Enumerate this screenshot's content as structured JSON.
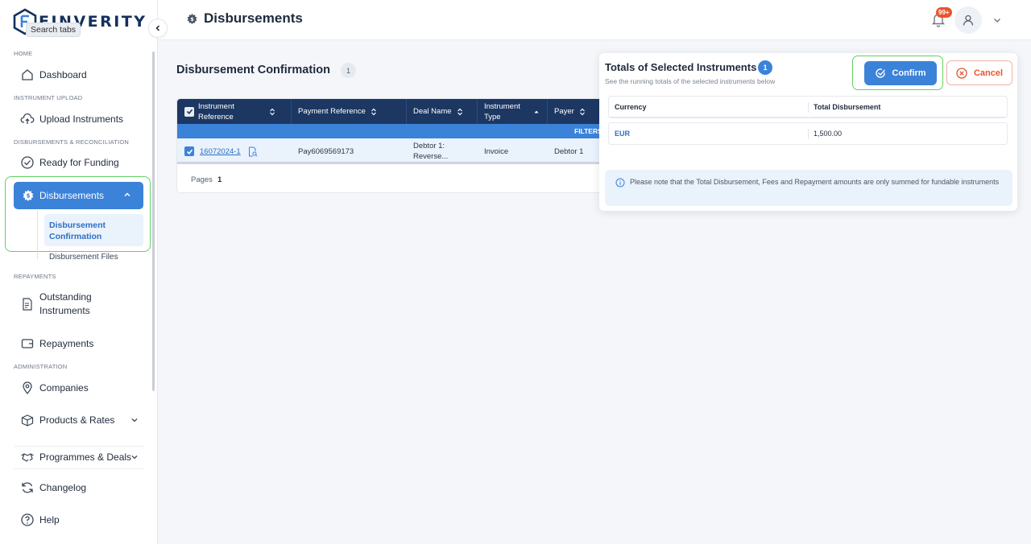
{
  "app": {
    "brand": "FINVERITY",
    "search_tooltip": "Search tabs"
  },
  "sidebar": {
    "sections": {
      "home": "HOME",
      "instrument_upload": "INSTRUMENT UPLOAD",
      "disbursements_reconciliation": "DISBURSEMENTS & RECONCILIATION",
      "repayments": "REPAYMENTS",
      "administration": "ADMINISTRATION"
    },
    "items": {
      "dashboard": "Dashboard",
      "upload_instruments": "Upload Instruments",
      "ready_for_funding": "Ready for Funding",
      "disbursements": "Disbursements",
      "disbursement_confirmation": "Disbursement Confirmation",
      "disbursement_files": "Disbursement Files",
      "outstanding_instruments": "Outstanding Instruments",
      "repayments": "Repayments",
      "companies": "Companies",
      "products_rates": "Products & Rates",
      "programmes_deals": "Programmes & Deals",
      "changelog": "Changelog",
      "help": "Help"
    }
  },
  "header": {
    "title": "Disbursements",
    "notifications_badge": "99+"
  },
  "main": {
    "title": "Disbursement Confirmation",
    "count": "1",
    "table": {
      "columns": [
        "Instrument Reference",
        "Payment Reference",
        "Deal Name",
        "Instrument Type",
        "Payer"
      ],
      "filters_label": "FILTERS",
      "rows": [
        {
          "instrument_reference": "16072024-1",
          "payment_reference": "Pay6069569173",
          "deal_name": "Debtor 1: Reverse...",
          "instrument_type": "Invoice",
          "payer": "Debtor 1"
        }
      ],
      "pages_label": "Pages",
      "page_number": "1"
    }
  },
  "totals_panel": {
    "title": "Totals of Selected Instruments",
    "count": "1",
    "subtitle": "See the running totals of the selected instruments below",
    "confirm_label": "Confirm",
    "cancel_label": "Cancel",
    "columns": [
      "Currency",
      "Total Disbursement"
    ],
    "rows": [
      {
        "currency": "EUR",
        "total_disbursement": "1,500.00"
      }
    ],
    "note": "Please note that the Total Disbursement, Fees and Repayment amounts are only summed for fundable instruments"
  },
  "colors": {
    "primary": "#3b82d9",
    "navy": "#1c3762",
    "danger": "#e9542c",
    "highlight": "#63d162"
  }
}
